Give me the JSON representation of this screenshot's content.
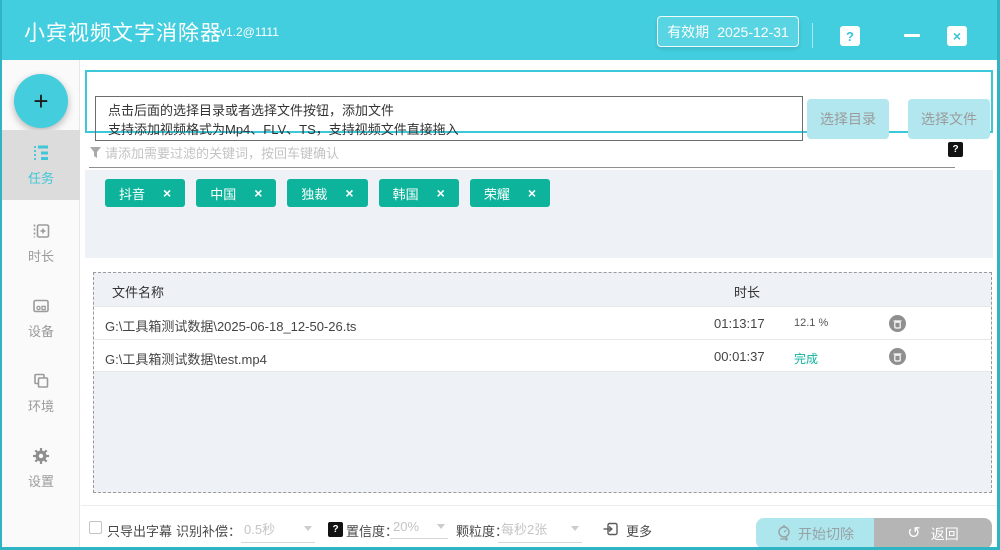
{
  "window": {
    "title": "小宾视频文字消除器",
    "version": "v1.2@1111",
    "validity_label": "有效期",
    "validity_date": "2025-12-31"
  },
  "icons": {
    "help_glyph": "?",
    "close_glyph": "×",
    "minimize": "minimize-bar",
    "add_glyph": "+",
    "dark_help_glyph": "?",
    "tag_close_glyph": "×",
    "back_glyph": "↺"
  },
  "colors": {
    "header_teal": "#43cedf",
    "accent_green": "#0db39a",
    "light_teal_button": "#b2e7ef",
    "panel_gray": "#eef1f5"
  },
  "sidebar": {
    "items": [
      {
        "label": "任务",
        "active": true
      },
      {
        "label": "时长",
        "active": false
      },
      {
        "label": "设备",
        "active": false
      },
      {
        "label": "环境",
        "active": false
      },
      {
        "label": "设置",
        "active": false
      }
    ]
  },
  "add_panel": {
    "line1": "点击后面的选择目录或者选择文件按钮，添加文件",
    "line2": "支持添加视频格式为Mp4、FLV、TS，支持视频文件直接拖入",
    "select_dir": "选择目录",
    "select_file": "选择文件"
  },
  "keyword": {
    "placeholder": "请添加需要过滤的关键词，按回车键确认",
    "tags": [
      "抖音",
      "中国",
      "独裁",
      "韩国",
      "荣耀"
    ]
  },
  "table": {
    "header_name": "文件名称",
    "header_duration": "时长",
    "rows": [
      {
        "name": "G:\\工具箱测试数据\\2025-06-18_12-50-26.ts",
        "duration": "01:13:17",
        "status": "12.1 %",
        "status_type": "progress"
      },
      {
        "name": "G:\\工具箱测试数据\\test.mp4",
        "duration": "00:01:37",
        "status": "完成",
        "status_type": "done"
      }
    ]
  },
  "footer": {
    "export_subtitle_label": "只导出字幕",
    "compensation_label": "识别补偿：",
    "compensation_value": "0.5秒",
    "confidence_label": "置信度：",
    "confidence_value": "20%",
    "granularity_label": "颗粒度：",
    "granularity_value": "每秒2张",
    "more_label": "更多",
    "start_label": "开始切除",
    "back_label": "返回"
  }
}
